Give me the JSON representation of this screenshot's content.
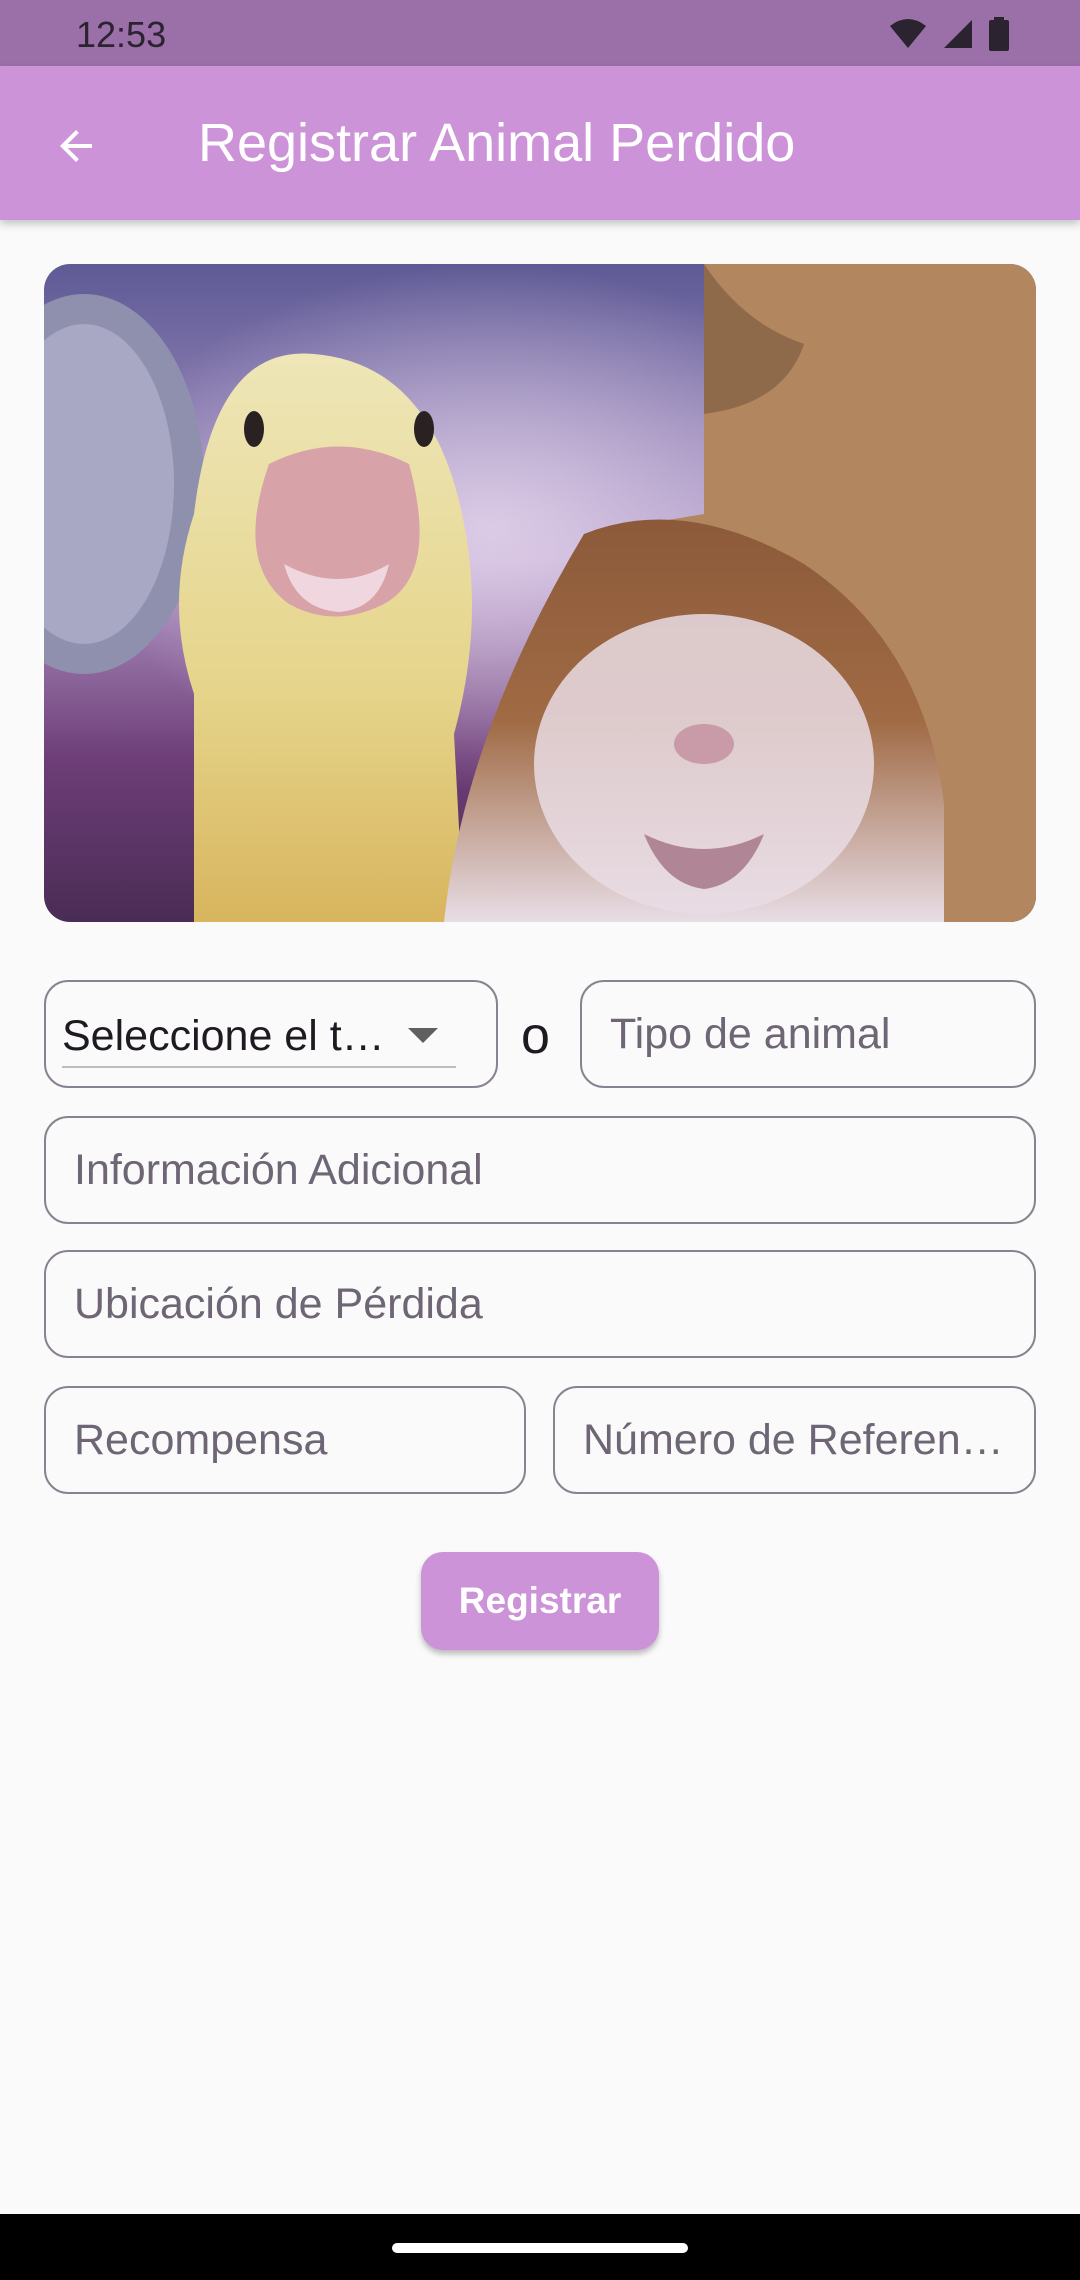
{
  "status_bar": {
    "time": "12:53"
  },
  "app_bar": {
    "title": "Registrar Animal Perdido",
    "back_icon": "arrow-back-icon",
    "background_color": "#CD93D8"
  },
  "photo": {
    "description_icon": "pet-photo"
  },
  "form": {
    "animal_type_dropdown": {
      "selected": "Seleccione el tipo de animal"
    },
    "or_label": "o",
    "animal_type_field": {
      "placeholder": "Tipo de animal"
    },
    "additional_info_field": {
      "placeholder": "Información Adicional"
    },
    "loss_location_field": {
      "placeholder": "Ubicación de Pérdida"
    },
    "reward_field": {
      "placeholder": "Recompensa"
    },
    "reference_number_field": {
      "placeholder": "Número de Referencia"
    },
    "submit_label": "Registrar"
  },
  "colors": {
    "accent": "#CD93D8",
    "status_bar": "#9B6FA8",
    "background": "#FAFAFA"
  }
}
